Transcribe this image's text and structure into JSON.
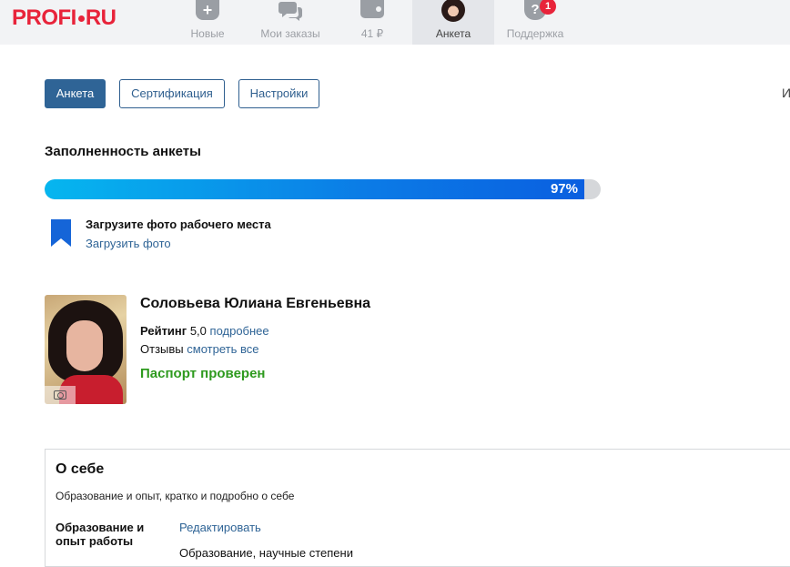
{
  "brand": {
    "logo_left": "PROFI",
    "logo_right": "RU",
    "color": "#e8233a"
  },
  "nav": {
    "items": [
      {
        "label": "Новые",
        "icon": "plus-bag-icon"
      },
      {
        "label": "Мои заказы",
        "icon": "chat-bubbles-icon"
      },
      {
        "label": "41 ₽",
        "icon": "wallet-icon"
      },
      {
        "label": "Анкета",
        "icon": "avatar",
        "active": true
      },
      {
        "label": "Поддержка",
        "icon": "question-icon",
        "badge": "1"
      }
    ]
  },
  "tabs": [
    {
      "label": "Анкета",
      "active": true
    },
    {
      "label": "Сертификация",
      "active": false
    },
    {
      "label": "Настройки",
      "active": false
    }
  ],
  "edge_text": "И",
  "completeness": {
    "title": "Заполненность анкеты",
    "percent_label": "97%",
    "percent": 97
  },
  "task": {
    "title": "Загрузите фото рабочего места",
    "link": "Загрузить фото",
    "icon": "bookmark-icon"
  },
  "profile": {
    "name": "Соловьева Юлиана Евгеньевна",
    "rating_label": "Рейтинг",
    "rating_value": "5,0",
    "rating_link": "подробнее",
    "reviews_label": "Отзывы",
    "reviews_link": "смотреть все",
    "verified": "Паспорт проверен"
  },
  "about": {
    "title": "О себе",
    "description": "Образование и опыт, кратко и подробно о себе",
    "label_line1": "Образование и",
    "label_line2": "опыт работы",
    "edit_link": "Редактировать",
    "cut_text": "Образование, научные степени"
  },
  "colors": {
    "accent": "#2f6496",
    "progress_start": "#06b6ef",
    "progress_end": "#0a5fe0",
    "verified": "#2e9a1e"
  }
}
